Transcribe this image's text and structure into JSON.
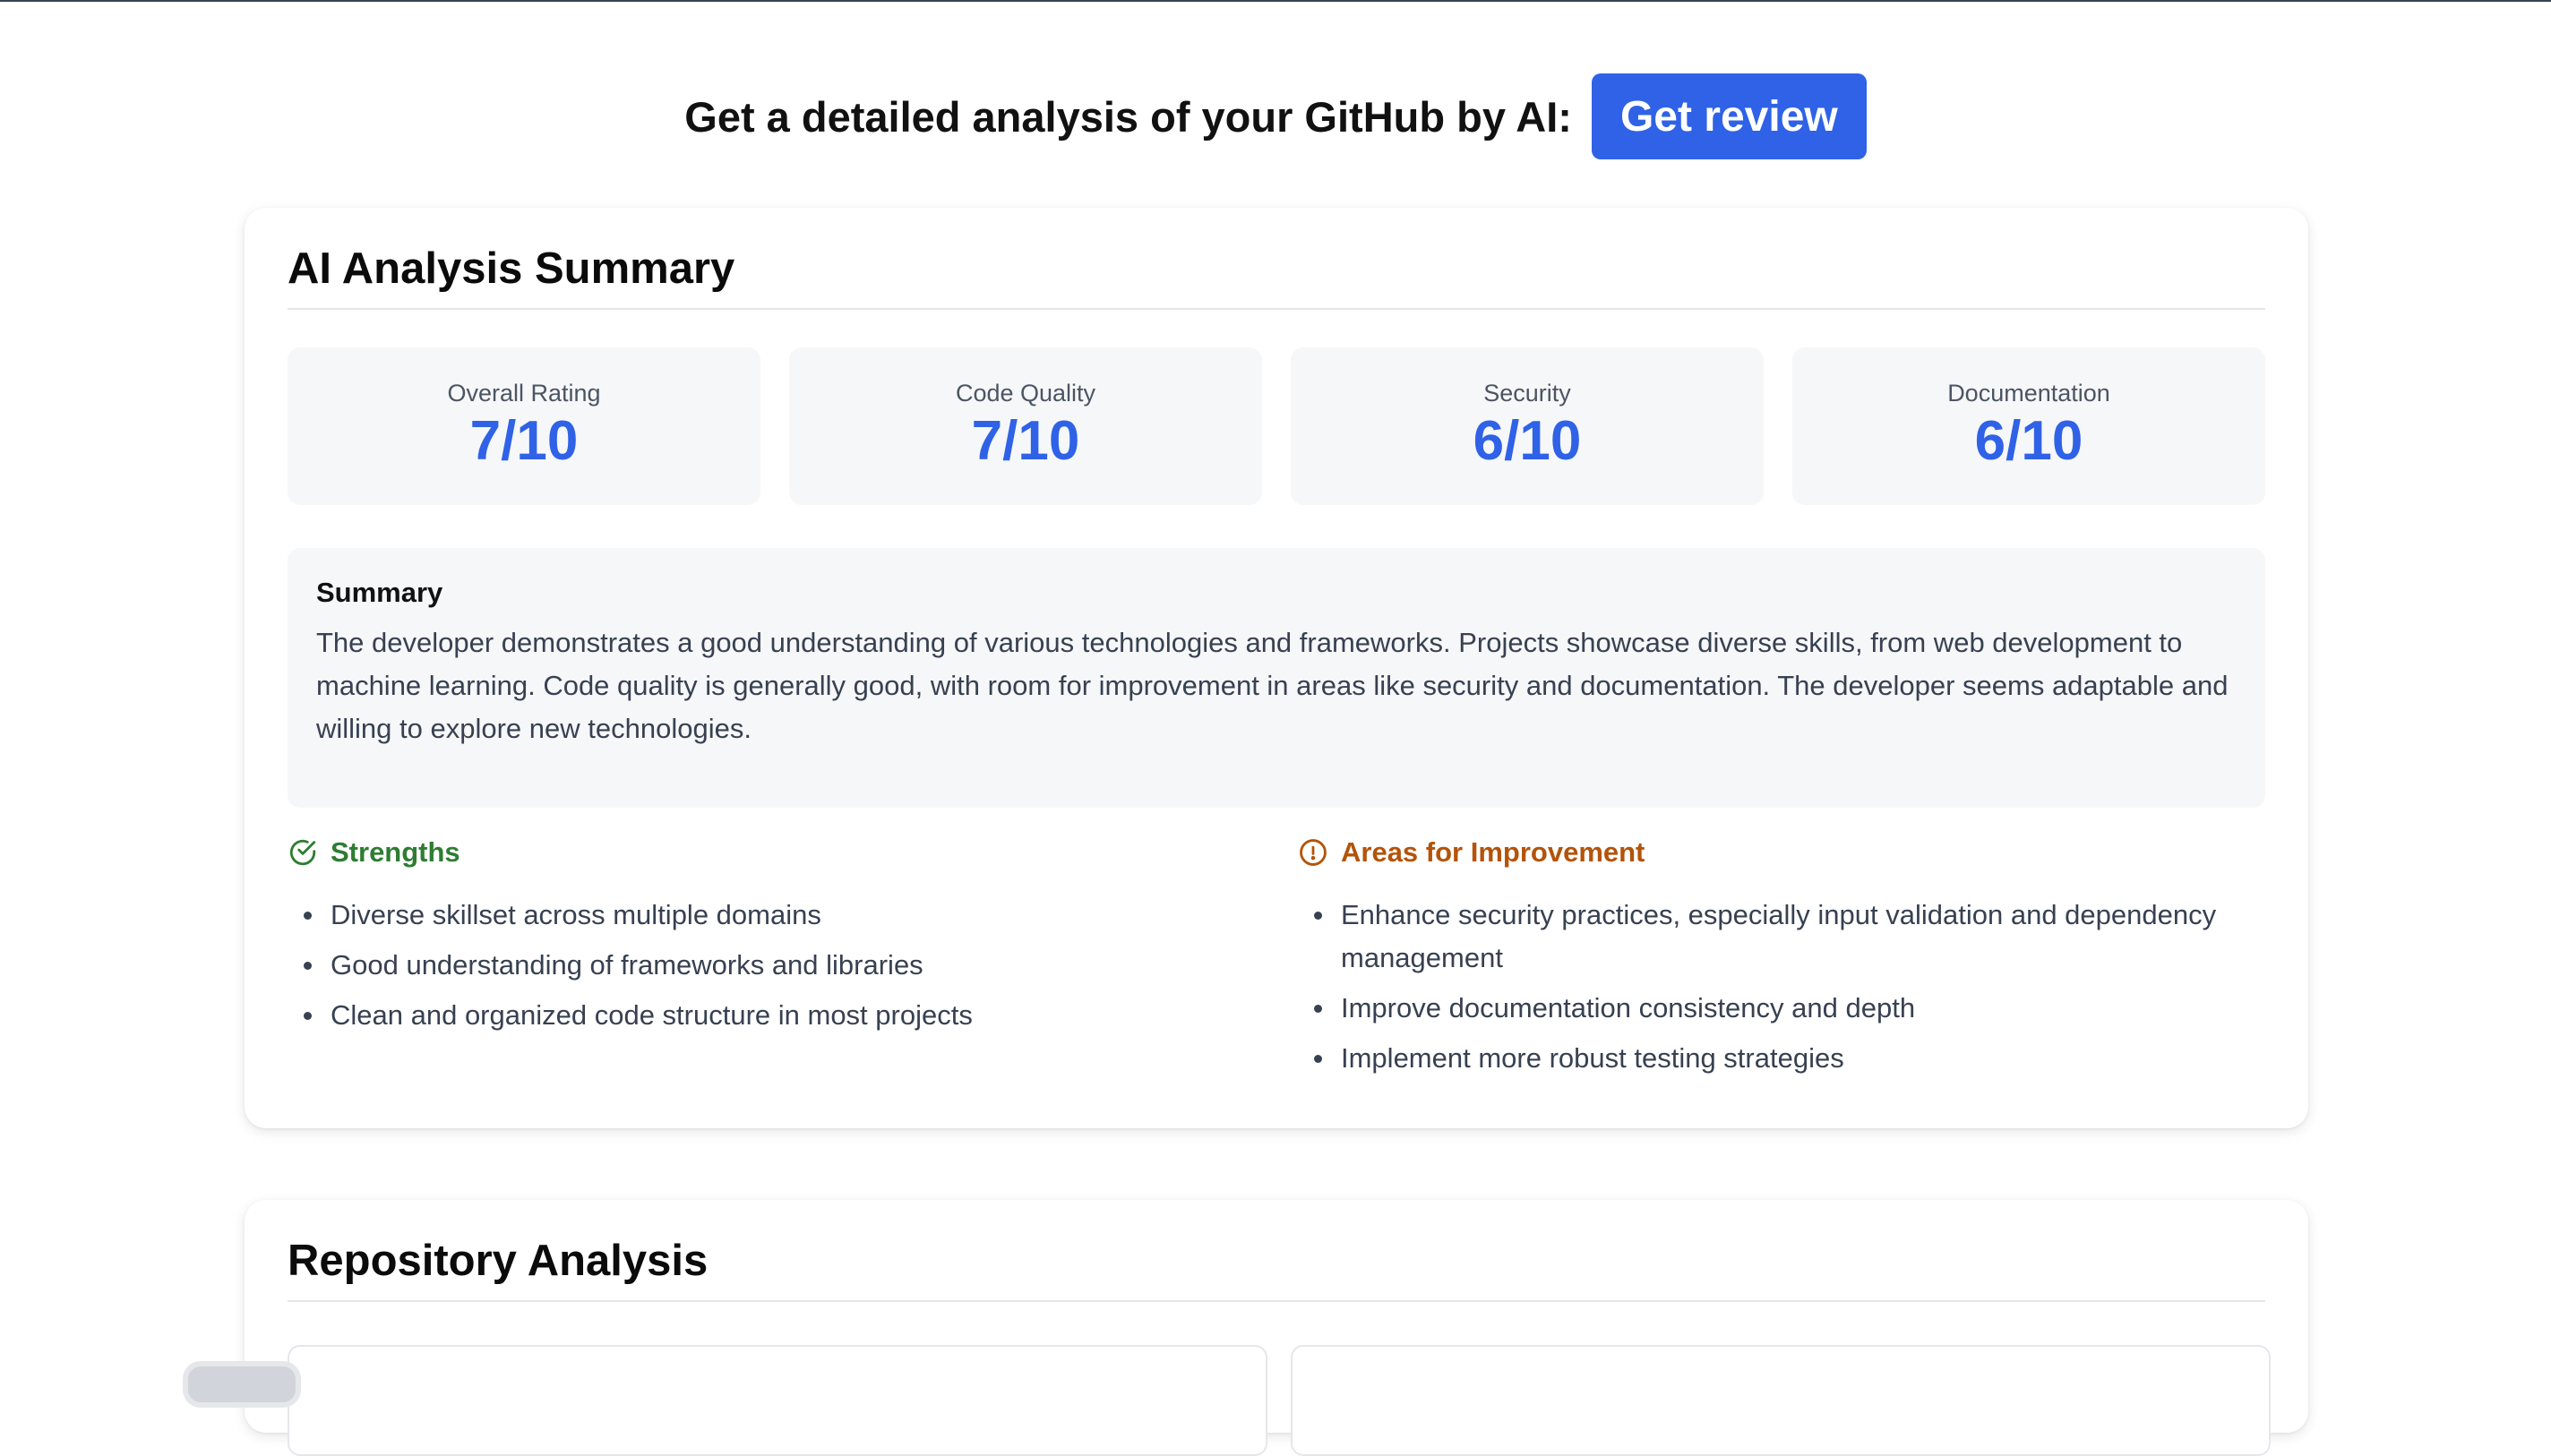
{
  "header": {
    "title": "Get a detailed analysis of your GitHub by AI:",
    "button_label": "Get review"
  },
  "summary_card": {
    "title": "AI Analysis Summary",
    "metrics": [
      {
        "label": "Overall Rating",
        "value": "7/10"
      },
      {
        "label": "Code Quality",
        "value": "7/10"
      },
      {
        "label": "Security",
        "value": "6/10"
      },
      {
        "label": "Documentation",
        "value": "6/10"
      }
    ],
    "summary": {
      "heading": "Summary",
      "text": "The developer demonstrates a good understanding of various technologies and frameworks. Projects showcase diverse skills, from web development to machine learning. Code quality is generally good, with room for improvement in areas like security and documentation. The developer seems adaptable and willing to explore new technologies."
    },
    "strengths": {
      "heading": "Strengths",
      "icon": "check-circle-icon",
      "color": "#2e7d32",
      "items": [
        "Diverse skillset across multiple domains",
        "Good understanding of frameworks and libraries",
        "Clean and organized code structure in most projects"
      ]
    },
    "improvements": {
      "heading": "Areas for Improvement",
      "icon": "info-circle-icon",
      "color": "#b45309",
      "items": [
        "Enhance security practices, especially input validation and dependency management",
        "Improve documentation consistency and depth",
        "Implement more robust testing strategies"
      ]
    }
  },
  "repo_card": {
    "title": "Repository Analysis"
  },
  "colors": {
    "accent": "#2f62e6",
    "panel_bg": "#f6f7f9"
  }
}
